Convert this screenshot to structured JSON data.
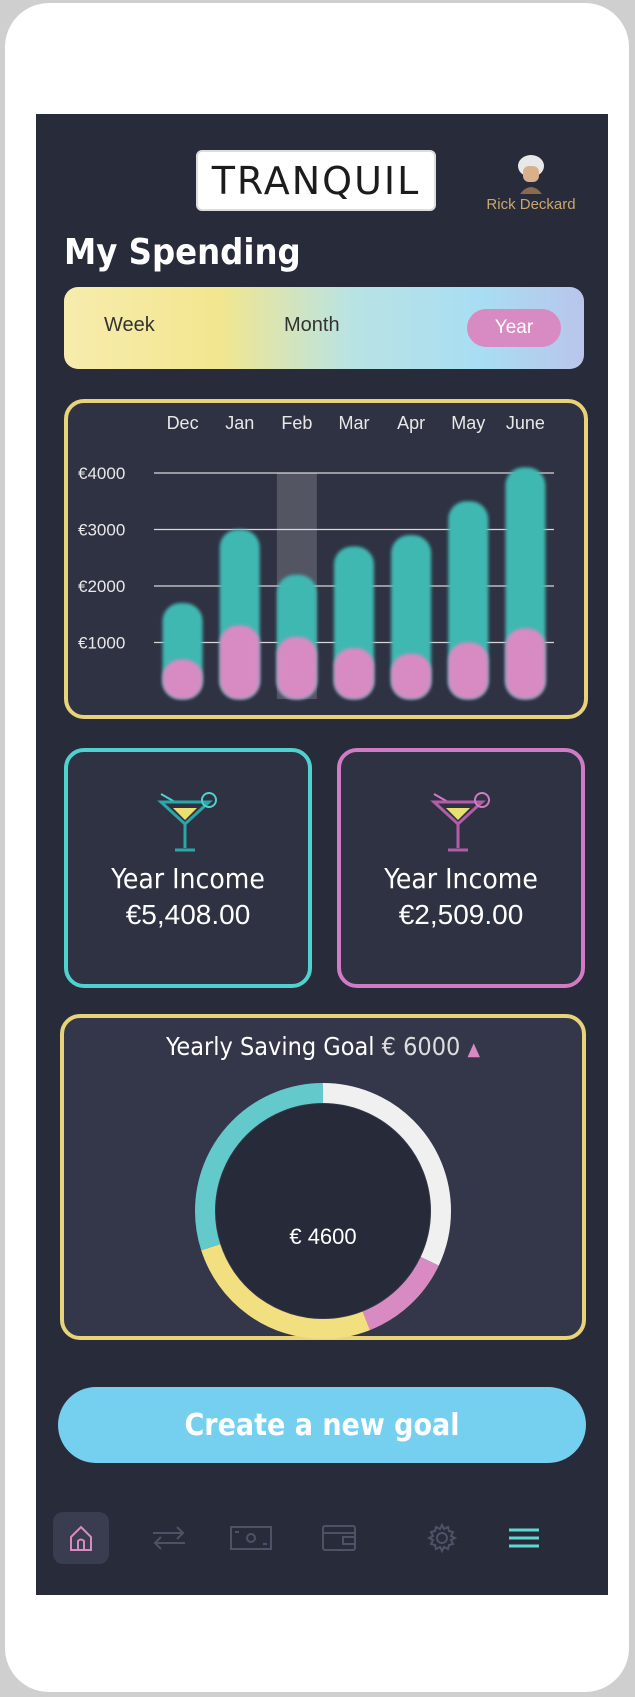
{
  "brand": {
    "logo_text": "TRANQUIL"
  },
  "user": {
    "name": "Rick Deckard"
  },
  "page": {
    "title": "My Spending"
  },
  "period_selector": {
    "options": [
      "Week",
      "Month",
      "Year"
    ],
    "selected": "Year"
  },
  "chart_data": {
    "type": "bar",
    "categories": [
      "Dec",
      "Jan",
      "Feb",
      "Mar",
      "Apr",
      "May",
      "June"
    ],
    "y_ticks": [
      "€4000",
      "€3000",
      "€2000",
      "€1000"
    ],
    "ylim": [
      0,
      4000
    ],
    "grid": true,
    "highlighted_category": "Feb",
    "series": [
      {
        "values": [
          1700,
          3000,
          2200,
          2700,
          2900,
          3500,
          4100
        ],
        "color": "#3fb8b2"
      },
      {
        "values": [
          700,
          1300,
          1100,
          900,
          800,
          1000,
          1250
        ],
        "color": "#d88bc2"
      }
    ]
  },
  "income_cards": [
    {
      "label": "Year Income",
      "value": "€5,408.00",
      "accent": "#4fd1cf",
      "icon": "cocktail-icon"
    },
    {
      "label": "Year Income",
      "value": "€2,509.00",
      "accent": "#d17ac6",
      "icon": "cocktail-icon"
    }
  ],
  "goal": {
    "label": "Yearly Saving Goal",
    "target": "€ 6000",
    "current": "€ 4600",
    "segments": [
      {
        "color": "#f0f0f0",
        "fraction": 0.32
      },
      {
        "color": "#d88bc2",
        "fraction": 0.12
      },
      {
        "color": "#f2df80",
        "fraction": 0.26
      },
      {
        "color": "#63c9cb",
        "fraction": 0.3
      }
    ]
  },
  "cta": {
    "label": "Create a new goal"
  },
  "nav": {
    "items": [
      "home-icon",
      "transfer-icon",
      "cash-icon",
      "wallet-icon",
      "settings-icon",
      "menu-icon"
    ]
  }
}
